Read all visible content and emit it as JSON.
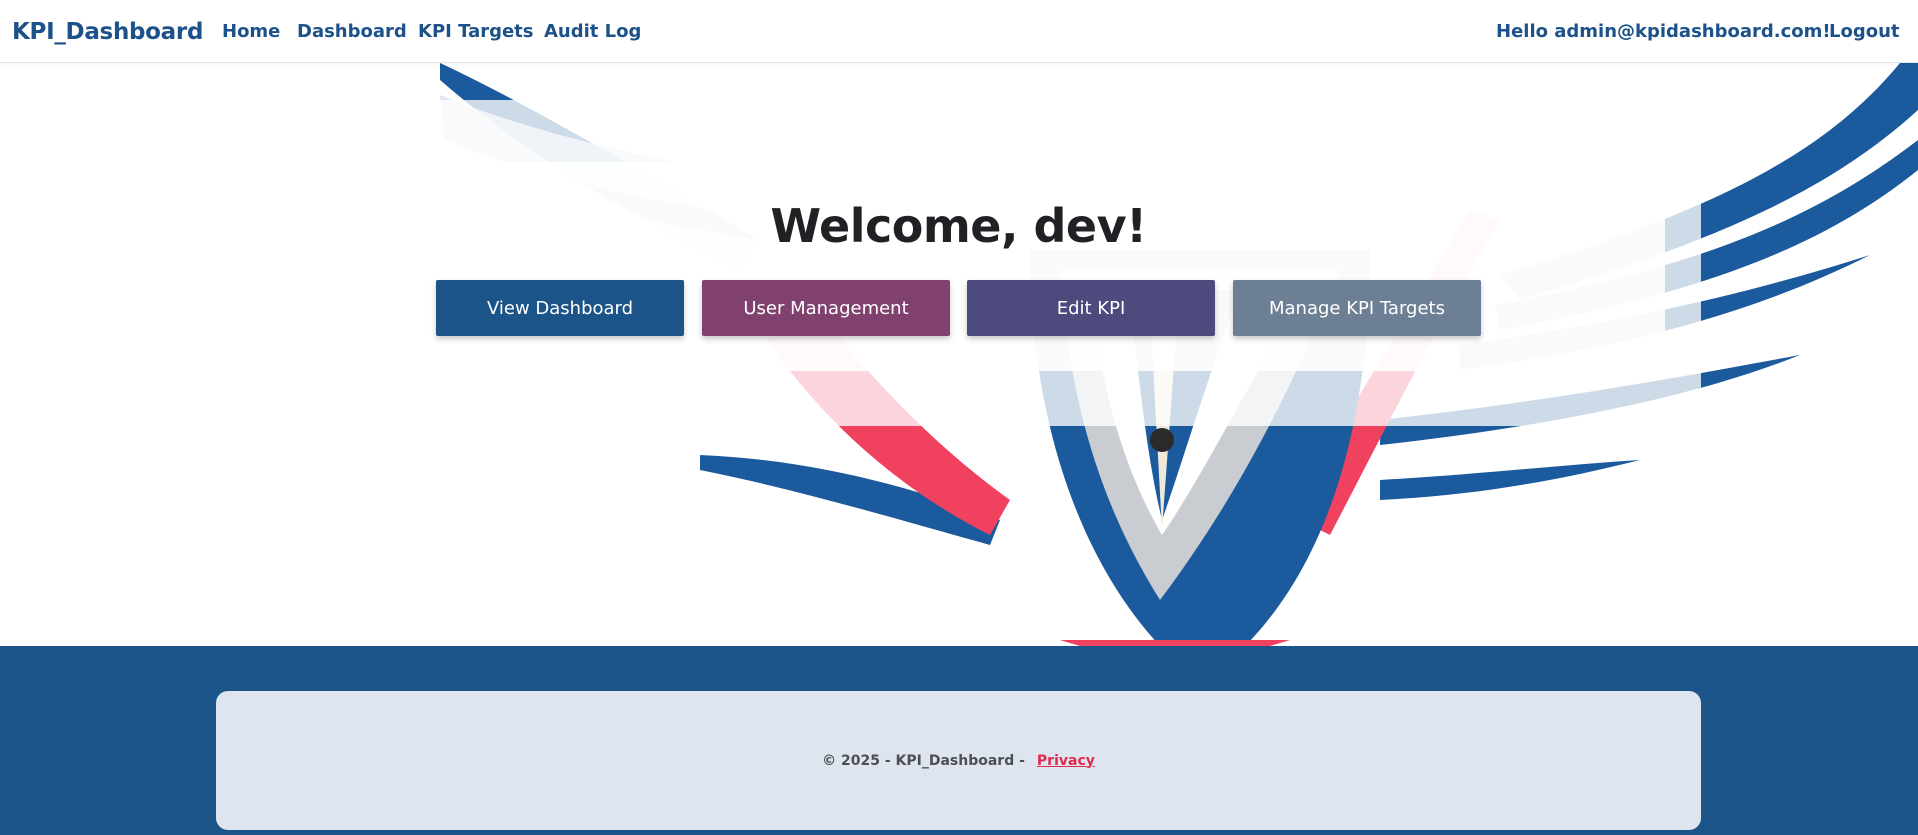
{
  "navbar": {
    "brand": "KPI_Dashboard",
    "links": [
      "Home",
      "Dashboard",
      "KPI Targets",
      "Audit Log"
    ],
    "greeting": "Hello admin@kpidashboard.com!",
    "logout": "Logout"
  },
  "main": {
    "welcome": "Welcome, dev!",
    "buttons": [
      {
        "label": "View Dashboard",
        "color": "#1b5489"
      },
      {
        "label": "User Management",
        "color": "#81416f"
      },
      {
        "label": "Edit KPI",
        "color": "#4d4a7e"
      },
      {
        "label": "Manage KPI Targets",
        "color": "#6d7f94"
      }
    ]
  },
  "footer": {
    "copyright": "© 2025 - KPI_Dashboard -",
    "privacy": "Privacy"
  },
  "colors": {
    "brand_blue": "#1c5189",
    "footer_bg": "#1b5489",
    "privacy_link": "#e0294f"
  }
}
